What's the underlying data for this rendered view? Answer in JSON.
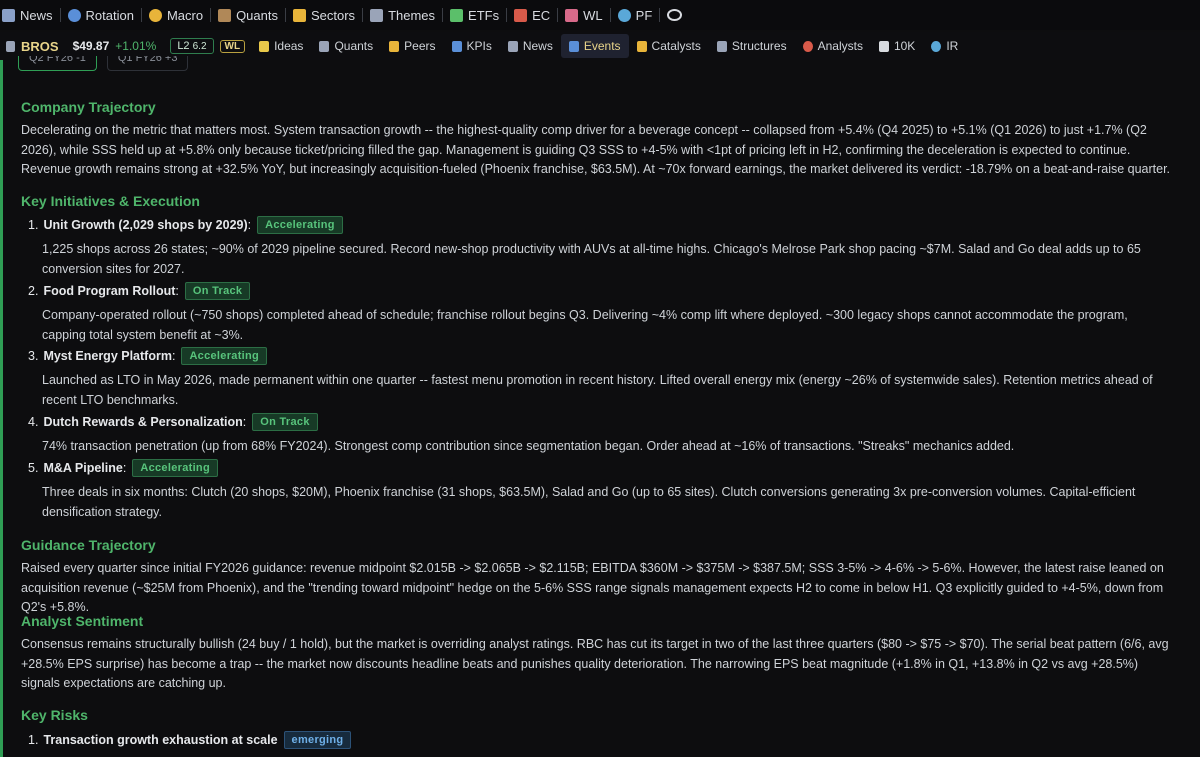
{
  "topnav": [
    {
      "label": "News",
      "icon": "newspaper-icon",
      "color": "#8aa0c8"
    },
    {
      "label": "Rotation",
      "icon": "rotation-icon",
      "color": "#5a8fd8"
    },
    {
      "label": "Macro",
      "icon": "globe-icon",
      "color": "#e8b43a"
    },
    {
      "label": "Quants",
      "icon": "grid-icon",
      "color": "#b08858"
    },
    {
      "label": "Sectors",
      "icon": "pie-icon",
      "color": "#e8b43a"
    },
    {
      "label": "Themes",
      "icon": "palette-icon",
      "color": "#9aa4b8"
    },
    {
      "label": "ETFs",
      "icon": "clover-icon",
      "color": "#5bbf6a"
    },
    {
      "label": "EC",
      "icon": "calendar-icon",
      "color": "#d85a4a"
    },
    {
      "label": "WL",
      "icon": "trend-chart-icon",
      "color": "#d86a8a"
    },
    {
      "label": "PF",
      "icon": "globe-pf-icon",
      "color": "#5aa8d8"
    },
    {
      "label": "",
      "icon": "eye-icon",
      "color": "#d8dbe0"
    }
  ],
  "subnav": {
    "ticker": "BROS",
    "price": "$49.87",
    "change": "+1.01%",
    "l2_label": "L2",
    "l2_value": "6.2",
    "wl": "WL",
    "items": [
      {
        "label": "Ideas",
        "icon": "lightbulb-icon",
        "color": "#e8c84a",
        "active": false
      },
      {
        "label": "Quants",
        "icon": "quants-icon",
        "color": "#9aa4b8",
        "active": false
      },
      {
        "label": "Peers",
        "icon": "shield-icon",
        "color": "#e8b43a",
        "active": false
      },
      {
        "label": "KPIs",
        "icon": "bar-chart-icon",
        "color": "#5a8fd8",
        "active": false
      },
      {
        "label": "News",
        "icon": "newspaper-icon",
        "color": "#9aa4b8",
        "active": false
      },
      {
        "label": "Events",
        "icon": "calendar-icon",
        "color": "#5a8fd8",
        "active": true
      },
      {
        "label": "Catalysts",
        "icon": "bell-icon",
        "color": "#e8b43a",
        "active": false
      },
      {
        "label": "Structures",
        "icon": "tools-icon",
        "color": "#9aa4b8",
        "active": false
      },
      {
        "label": "Analysts",
        "icon": "target-icon",
        "color": "#d85a4a",
        "active": false
      },
      {
        "label": "10K",
        "icon": "document-icon",
        "color": "#d8dbe0",
        "active": false
      },
      {
        "label": "IR",
        "icon": "globe-ir-icon",
        "color": "#5aa8d8",
        "active": false
      }
    ]
  },
  "quarter_tabs": [
    "Q2 FY26 -1",
    "Q1 FY26 +3"
  ],
  "sections": {
    "trajectory": {
      "title": "Company Trajectory",
      "body": "Decelerating on the metric that matters most. System transaction growth -- the highest-quality comp driver for a beverage concept -- collapsed from +5.4% (Q4 2025) to +5.1% (Q1 2026) to just +1.7% (Q2 2026), while SSS held up at +5.8% only because ticket/pricing filled the gap. Management is guiding Q3 SSS to +4-5% with <1pt of pricing left in H2, confirming the deceleration is expected to continue. Revenue growth remains strong at +32.5% YoY, but increasingly acquisition-fueled (Phoenix franchise, $63.5M). At ~70x forward earnings, the market delivered its verdict: -18.79% on a beat-and-raise quarter."
    },
    "initiatives": {
      "title": "Key Initiatives & Execution",
      "items": [
        {
          "num": "1.",
          "name": "Unit Growth (2,029 shops by 2029)",
          "status": "Accelerating",
          "text": "1,225 shops across 26 states; ~90% of 2029 pipeline secured. Record new-shop productivity with AUVs at all-time highs. Chicago's Melrose Park shop pacing ~$7M. Salad and Go deal adds up to 65 conversion sites for 2027."
        },
        {
          "num": "2.",
          "name": "Food Program Rollout",
          "status": "On Track",
          "text": "Company-operated rollout (~750 shops) completed ahead of schedule; franchise rollout begins Q3. Delivering ~4% comp lift where deployed. ~300 legacy shops cannot accommodate the program, capping total system benefit at ~3%."
        },
        {
          "num": "3.",
          "name": "Myst Energy Platform",
          "status": "Accelerating",
          "text": "Launched as LTO in May 2026, made permanent within one quarter -- fastest menu promotion in recent history. Lifted overall energy mix (energy ~26% of systemwide sales). Retention metrics ahead of recent LTO benchmarks."
        },
        {
          "num": "4.",
          "name": "Dutch Rewards & Personalization",
          "status": "On Track",
          "text": "74% transaction penetration (up from 68% FY2024). Strongest comp contribution since segmentation began. Order ahead at ~16% of transactions. \"Streaks\" mechanics added."
        },
        {
          "num": "5.",
          "name": "M&A Pipeline",
          "status": "Accelerating",
          "text": "Three deals in six months: Clutch (20 shops, $20M), Phoenix franchise (31 shops, $63.5M), Salad and Go (up to 65 sites). Clutch conversions generating 3x pre-conversion volumes. Capital-efficient densification strategy."
        }
      ]
    },
    "guidance": {
      "title": "Guidance Trajectory",
      "body": "Raised every quarter since initial FY2026 guidance: revenue midpoint $2.015B -> $2.065B -> $2.115B; EBITDA $360M -> $375M -> $387.5M; SSS 3-5% -> 4-6% -> 5-6%. However, the latest raise leaned on acquisition revenue (~$25M from Phoenix), and the \"trending toward midpoint\" hedge on the 5-6% SSS range signals management expects H2 to come in below H1. Q3 explicitly guided to +4-5%, down from Q2's +5.8%."
    },
    "sentiment": {
      "title": "Analyst Sentiment",
      "body": "Consensus remains structurally bullish (24 buy / 1 hold), but the market is overriding analyst ratings. RBC has cut its target in two of the last three quarters ($80 -> $75 -> $70). The serial beat pattern (6/6, avg +28.5% EPS surprise) has become a trap -- the market now discounts headline beats and punishes quality deterioration. The narrowing EPS beat magnitude (+1.8% in Q1, +13.8% in Q2 vs avg +28.5%) signals expectations are catching up."
    },
    "risks": {
      "title": "Key Risks",
      "items": [
        {
          "num": "1.",
          "name": "Transaction growth exhaustion at scale",
          "status": "emerging"
        }
      ]
    }
  }
}
